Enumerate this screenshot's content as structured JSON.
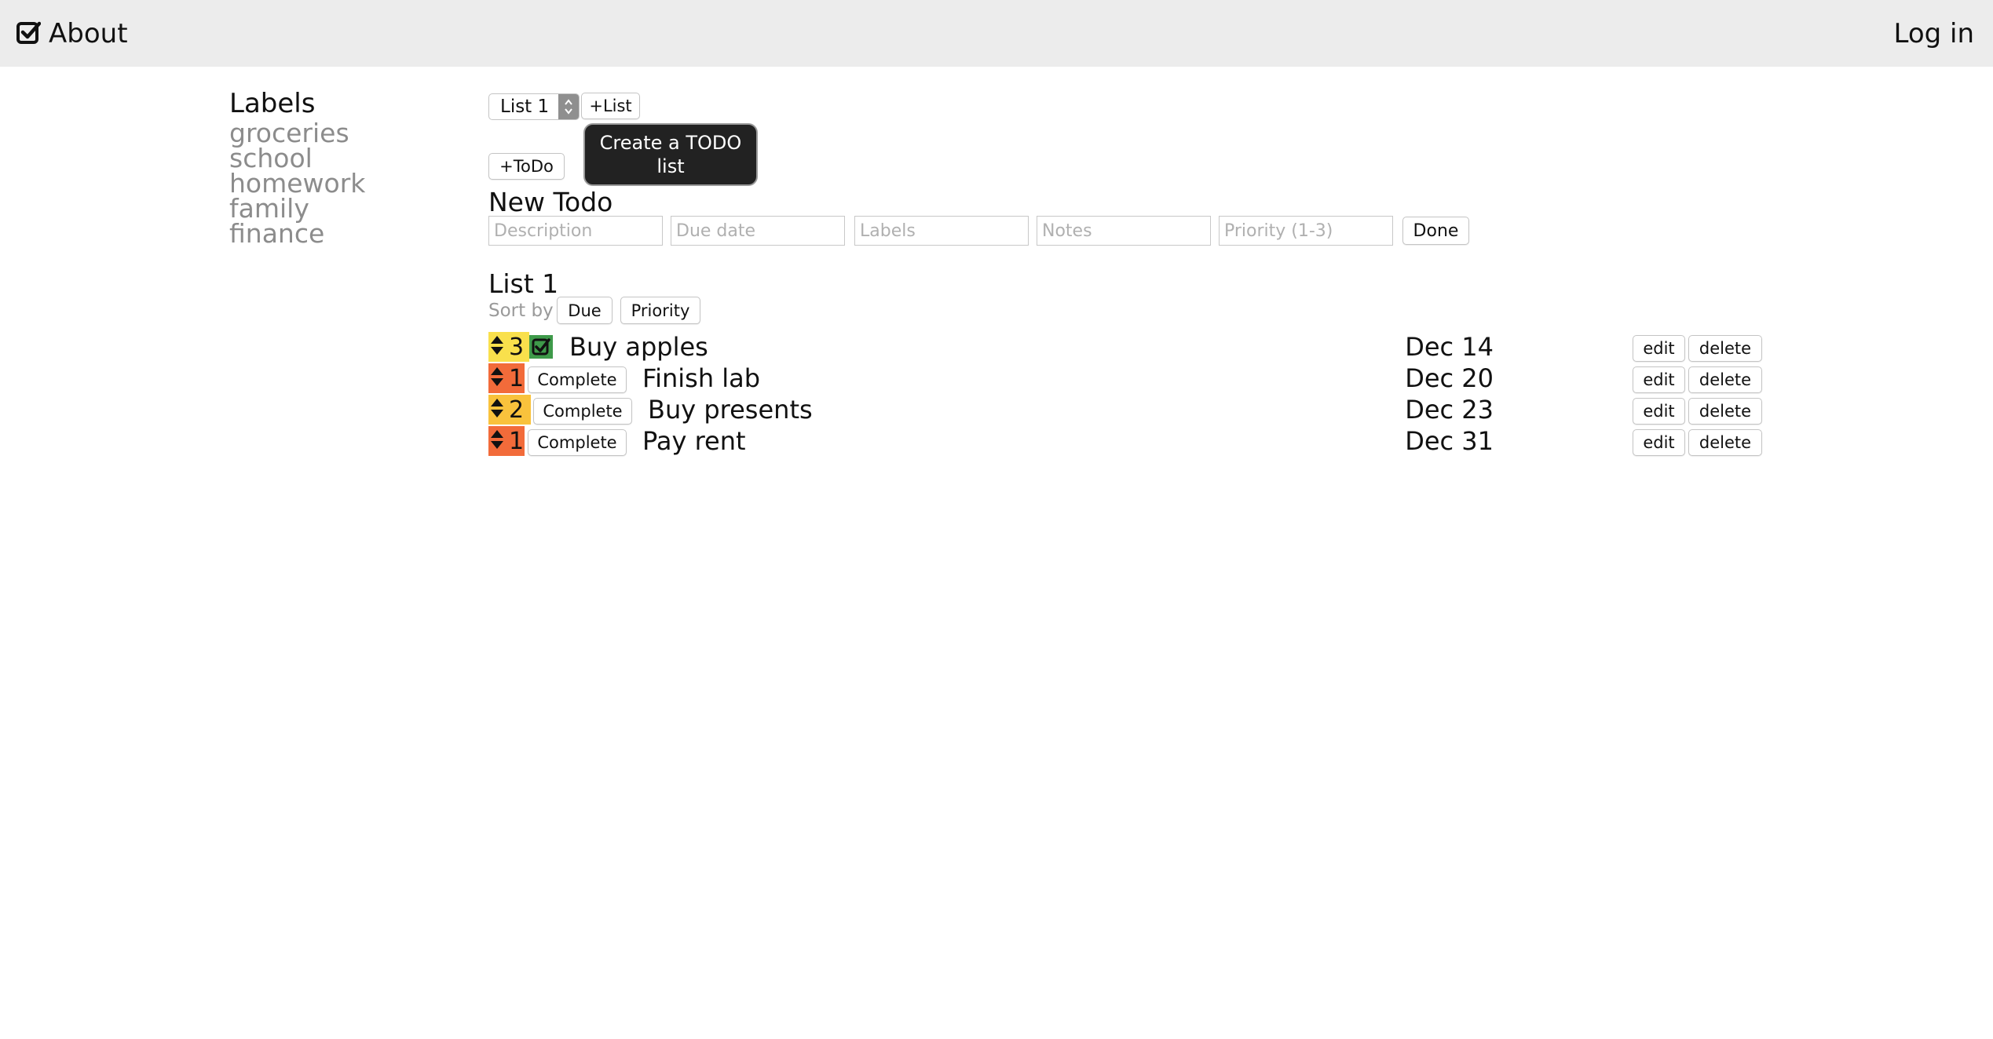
{
  "header": {
    "brand_label": "About",
    "login_label": "Log in",
    "background": "#ececec"
  },
  "sidebar": {
    "title": "Labels",
    "labels": [
      "groceries",
      "school",
      "homework",
      "family",
      "finance"
    ]
  },
  "toolbar": {
    "list_select_value": "List 1",
    "add_list_label": "+List",
    "add_todo_label": "+ToDo",
    "tooltip": "Create a TODO list"
  },
  "new_todo": {
    "title": "New Todo",
    "placeholders": {
      "description": "Description",
      "due_date": "Due date",
      "labels": "Labels",
      "notes": "Notes",
      "priority": "Priority (1-3)"
    },
    "done_label": "Done"
  },
  "list": {
    "title": "List 1",
    "sort_by_label": "Sort by",
    "sort_due_label": "Due",
    "sort_priority_label": "Priority",
    "complete_label": "Complete",
    "edit_label": "edit",
    "delete_label": "delete",
    "priority_colors": {
      "1": "#f26b3a",
      "2": "#f9c23c",
      "3": "#f9e04c"
    },
    "completed_color": "#3e9a4a",
    "todos": [
      {
        "priority": "3",
        "text": "Buy apples",
        "due": "Dec 14",
        "completed": true
      },
      {
        "priority": "1",
        "text": "Finish lab",
        "due": "Dec 20",
        "completed": false
      },
      {
        "priority": "2",
        "text": "Buy presents",
        "due": "Dec 23",
        "completed": false
      },
      {
        "priority": "1",
        "text": "Pay rent",
        "due": "Dec 31",
        "completed": false
      }
    ]
  }
}
